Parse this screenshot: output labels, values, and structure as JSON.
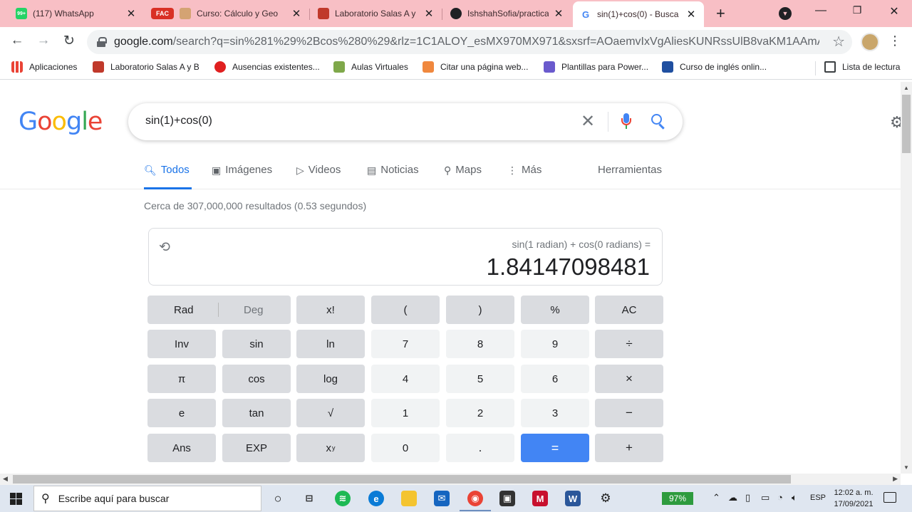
{
  "browser": {
    "tabs": [
      {
        "title": "(117) WhatsApp",
        "badge": "99+",
        "icon": "whatsapp-icon",
        "color": "#25d366"
      },
      {
        "title": "Curso: Cálculo y Geo",
        "badge": "FAC",
        "icon": "course-icon",
        "color": "#d93025"
      },
      {
        "title": "Laboratorio Salas A y",
        "icon": "lab-icon",
        "color": "#c0392b"
      },
      {
        "title": "IshshahSofia/practica",
        "icon": "github-icon",
        "color": "#202124"
      },
      {
        "title": "sin(1)+cos(0) - Busca",
        "icon": "google-icon",
        "color": "#4285f4",
        "active": true
      }
    ],
    "url_host": "google.com",
    "url_rest": "/search?q=sin%281%29%2Bcos%280%29&rlz=1C1ALOY_esMX970MX971&sxsrf=AOaemvIxVgAliesKUNRssUlB8vaKM1AAmA%3A...",
    "bookmarks": [
      {
        "label": "Aplicaciones",
        "icon": "apps-grid-icon",
        "color": "#ea4335"
      },
      {
        "label": "Laboratorio Salas A y B",
        "icon": "lab-icon",
        "color": "#c0392b"
      },
      {
        "label": "Ausencias existentes...",
        "icon": "oracle-icon",
        "color": "#e02020"
      },
      {
        "label": "Aulas Virtuales",
        "icon": "aulas-icon",
        "color": "#7fa84a"
      },
      {
        "label": "Citar una página web...",
        "icon": "cite-icon",
        "color": "#f0883e"
      },
      {
        "label": "Plantillas para Power...",
        "icon": "templates-icon",
        "color": "#6a5acd"
      },
      {
        "label": "Curso de inglés onlin...",
        "icon": "english-icon",
        "color": "#1f4fa0"
      }
    ],
    "reading_list": "Lista de lectura"
  },
  "google": {
    "query": "sin(1)+cos(0)",
    "tabs": [
      "Todos",
      "Imágenes",
      "Videos",
      "Noticias",
      "Maps",
      "Más"
    ],
    "tools": "Herramientas",
    "stats": "Cerca de 307,000,000 resultados (0.53 segundos)"
  },
  "calculator": {
    "expression": "sin(1 radian) + cos(0 radians) =",
    "result": "1.84147098481",
    "rad": "Rad",
    "deg": "Deg",
    "keys": {
      "fact": "x!",
      "lparen": "(",
      "rparen": ")",
      "percent": "%",
      "ac": "AC",
      "inv": "Inv",
      "sin": "sin",
      "ln": "ln",
      "k7": "7",
      "k8": "8",
      "k9": "9",
      "div": "÷",
      "pi": "π",
      "cos": "cos",
      "log": "log",
      "k4": "4",
      "k5": "5",
      "k6": "6",
      "mul": "×",
      "e": "e",
      "tan": "tan",
      "sqrt": "√",
      "k1": "1",
      "k2": "2",
      "k3": "3",
      "minus": "−",
      "ans": "Ans",
      "exp": "EXP",
      "pow_base": "x",
      "pow_exp": "y",
      "k0": "0",
      "dot": ".",
      "eq": "=",
      "plus": "+"
    }
  },
  "taskbar": {
    "search_placeholder": "Escribe aquí para buscar",
    "battery": "97%",
    "lang": "ESP",
    "time": "12:02 a. m.",
    "date": "17/09/2021"
  }
}
